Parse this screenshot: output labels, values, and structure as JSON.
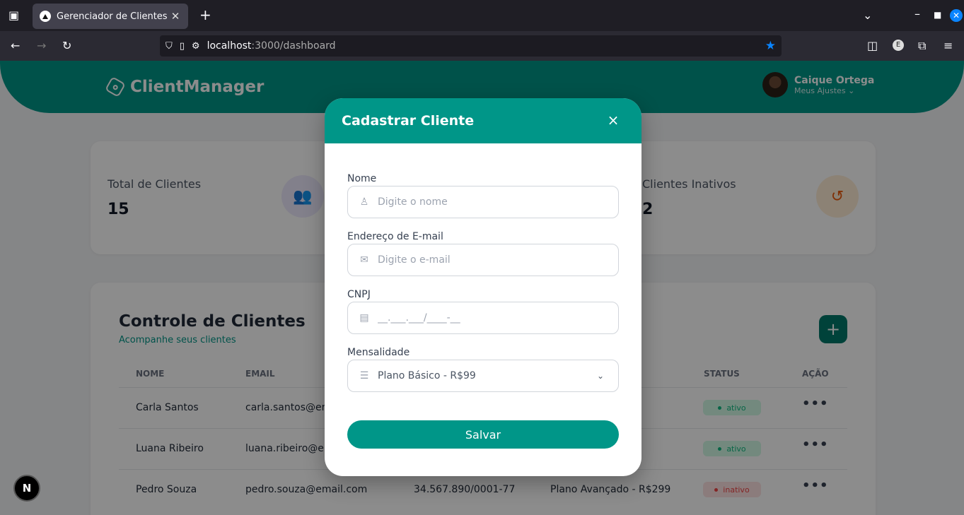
{
  "browser": {
    "tab_title": "Gerenciador de Clientes",
    "url_host": "localhost",
    "url_rest": ":3000/dashboard"
  },
  "header": {
    "brand": "ClientManager",
    "user_name": "Caique Ortega",
    "user_sub": "Meus Ajustes"
  },
  "stats": {
    "total_label": "Total de Clientes",
    "total_value": "15",
    "inactive_label": "Clientes Inativos",
    "inactive_value": "2"
  },
  "section": {
    "title": "Controle de Clientes",
    "subtitle": "Acompanhe seus clientes",
    "add_label": "+"
  },
  "table": {
    "headers": {
      "name": "NOME",
      "email": "EMAIL",
      "status": "STATUS",
      "action": "AÇÃO"
    },
    "rows": [
      {
        "name": "Carla Santos",
        "email": "carla.santos@email.com",
        "cnpj": "",
        "plan": "",
        "status": "ativo"
      },
      {
        "name": "Luana Ribeiro",
        "email": "luana.ribeiro@email.com",
        "cnpj": "",
        "plan": "",
        "status": "ativo"
      },
      {
        "name": "Pedro Souza",
        "email": "pedro.souza@email.com",
        "cnpj": "34.567.890/0001-77",
        "plan": "Plano Avançado - R$299",
        "status": "inativo"
      }
    ]
  },
  "modal": {
    "title": "Cadastrar Cliente",
    "close": "×",
    "name_label": "Nome",
    "name_placeholder": "Digite o nome",
    "email_label": "Endereço de E-mail",
    "email_placeholder": "Digite o e-mail",
    "cnpj_label": "CNPJ",
    "cnpj_placeholder": "__.___.___/____-__",
    "plan_label": "Mensalidade",
    "plan_value": "Plano Básico - R$99",
    "save_label": "Salvar"
  },
  "colors": {
    "primary": "#009688",
    "primary_dark": "#00796b",
    "active": "#10b981",
    "inactive": "#ef4444"
  }
}
